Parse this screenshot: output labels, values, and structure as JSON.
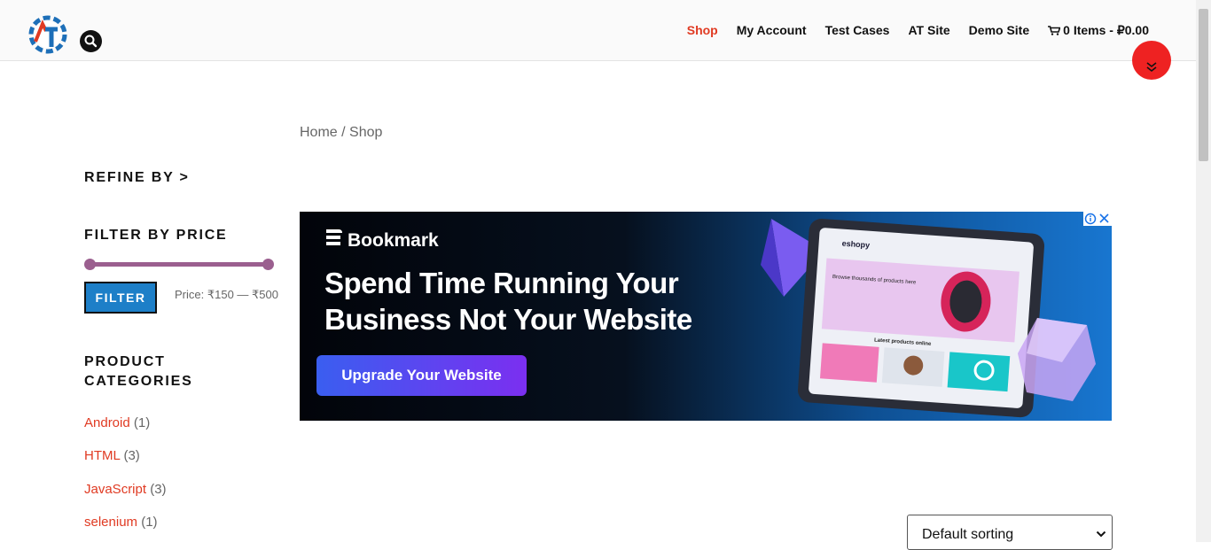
{
  "header": {
    "logo_letters": "AT",
    "nav": [
      {
        "label": "Shop",
        "active": true
      },
      {
        "label": "My Account"
      },
      {
        "label": "Test Cases"
      },
      {
        "label": "AT Site"
      },
      {
        "label": "Demo Site"
      }
    ],
    "cart_label": "0 Items - ₽0.00"
  },
  "breadcrumb": "Home / Shop",
  "sidebar": {
    "refine_title": "REFINE BY >",
    "filter_title": "FILTER BY PRICE",
    "price_slider": {
      "min": 150,
      "max": 500,
      "selected_min_fraction": 0,
      "selected_max_fraction": 1
    },
    "filter_button": "FILTER",
    "price_label": "Price: ₹150 — ₹500",
    "categories_title": "PRODUCT CATEGORIES",
    "categories": [
      {
        "name": "Android",
        "count": "(1)"
      },
      {
        "name": "HTML",
        "count": "(3)"
      },
      {
        "name": "JavaScript",
        "count": "(3)"
      },
      {
        "name": "selenium",
        "count": "(1)"
      }
    ]
  },
  "ad": {
    "brand": "Bookmark",
    "headline": "Spend Time Running Your Business Not Your Website",
    "cta": "Upgrade Your Website",
    "screen_logo": "eshopy",
    "screen_text": "Browse thousands of products here",
    "screen_sub": "Latest products online"
  },
  "sort": {
    "selected": "Default sorting"
  },
  "colors": {
    "accent": "#e03a22",
    "filter_button": "#1d7fc8",
    "slider": "#9b5f8f",
    "float_button": "#ee2222"
  },
  "icons": [
    "logo-gear-icon",
    "search-icon",
    "cart-icon",
    "double-chevron-down-icon",
    "bookmark-logo-icon",
    "ad-choices-icon",
    "chevron-down-icon"
  ]
}
